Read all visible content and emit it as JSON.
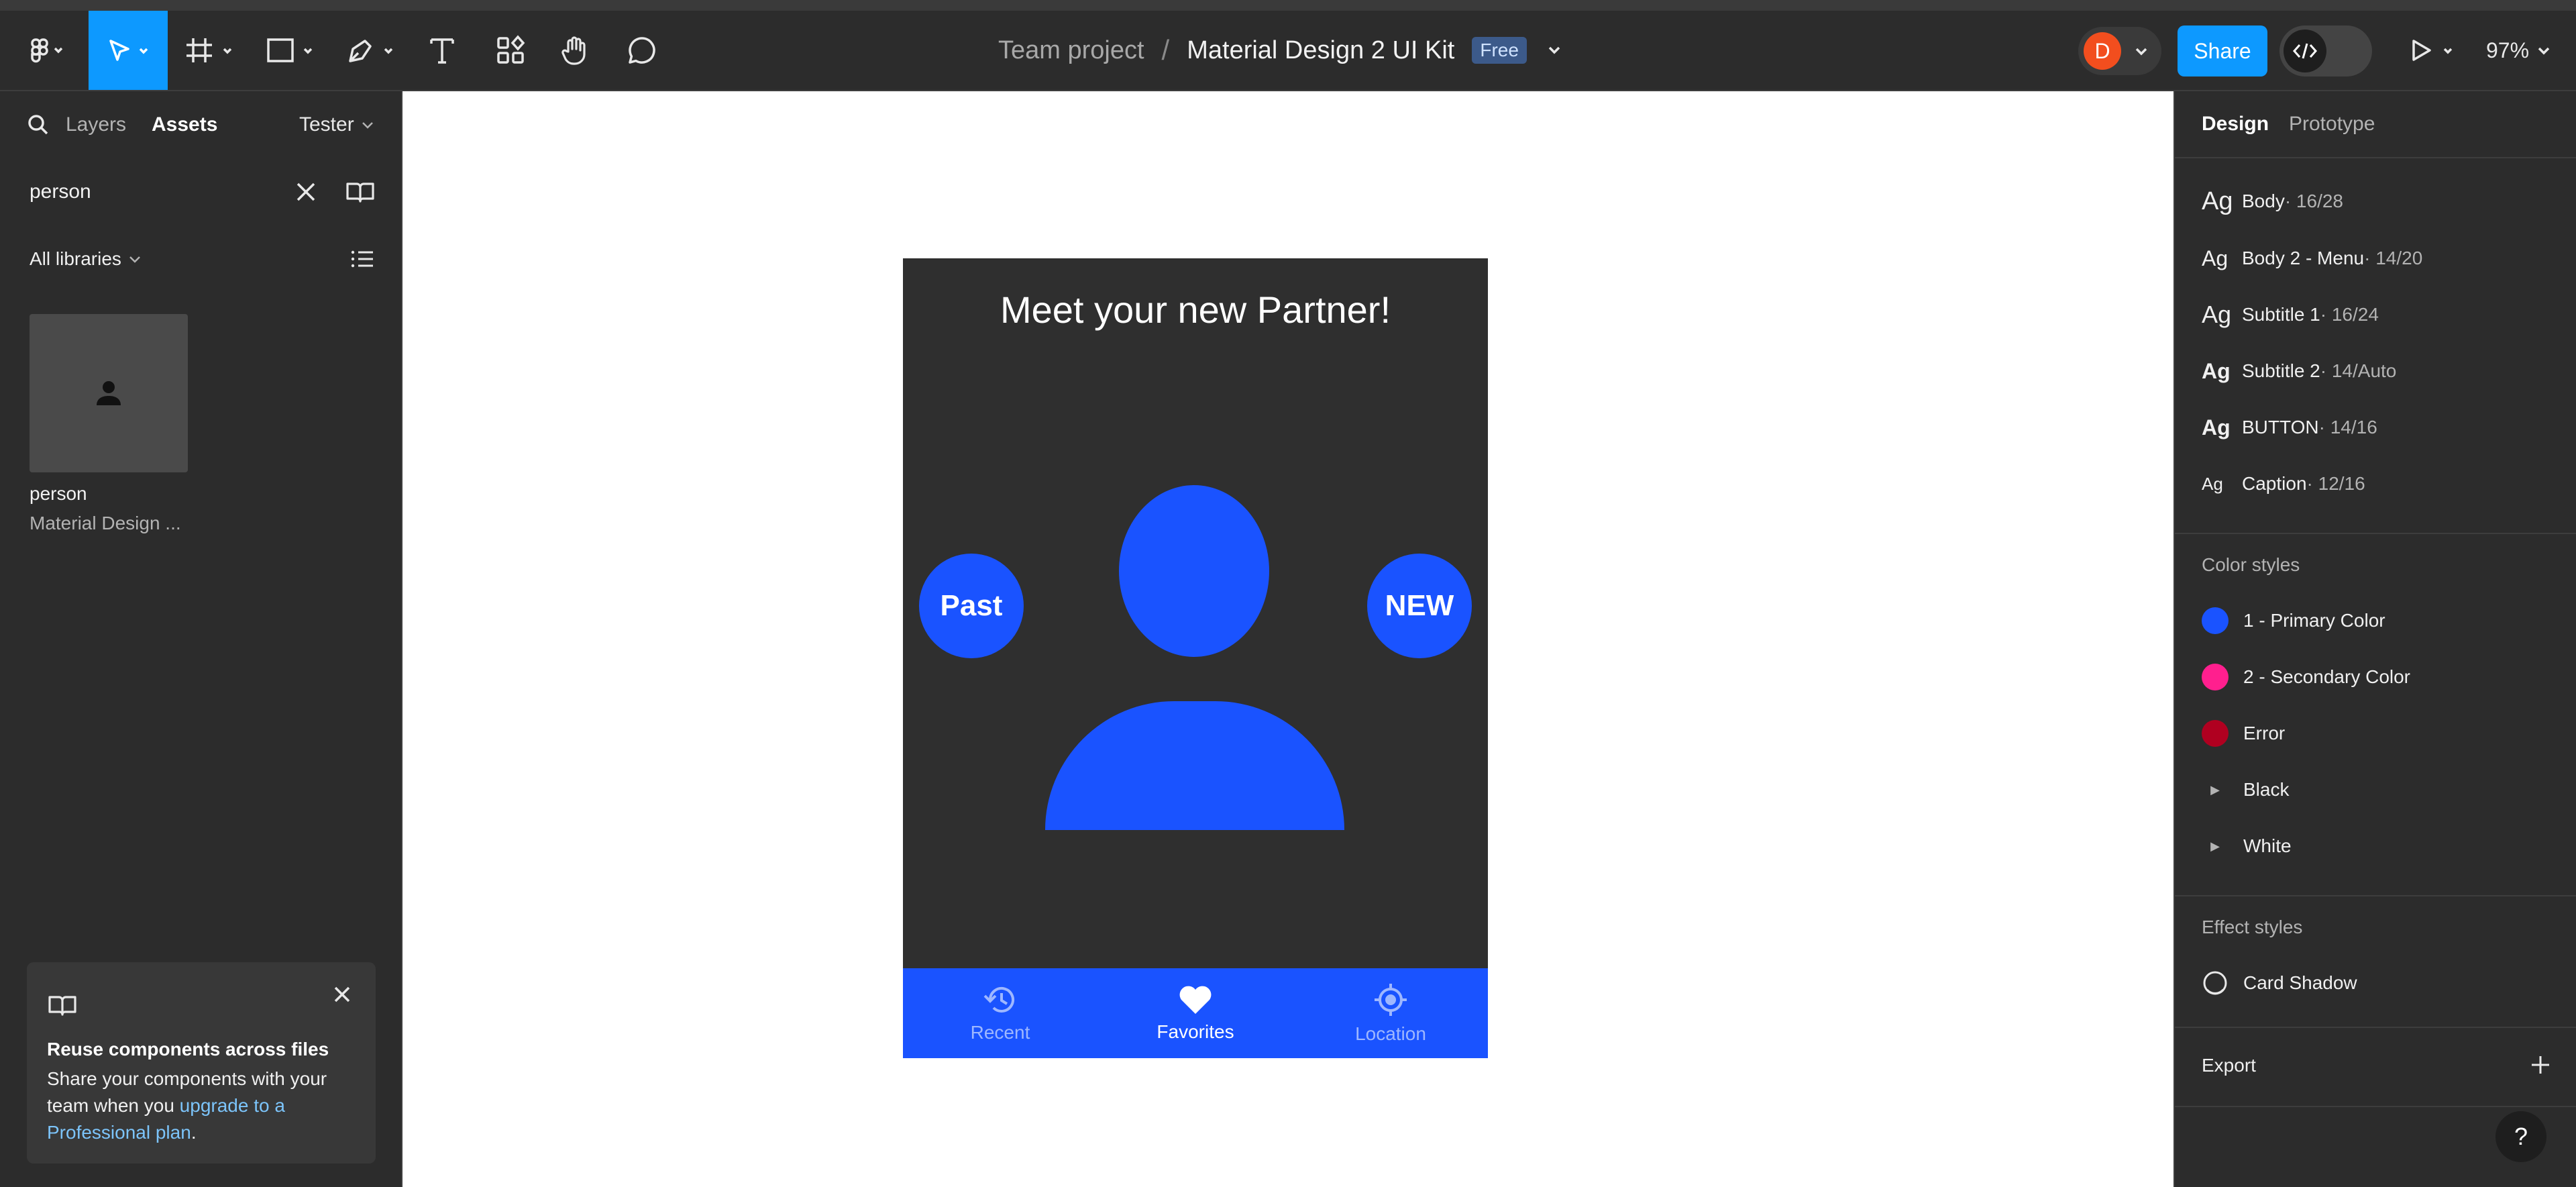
{
  "toolbar": {
    "breadcrumb_team": "Team project",
    "breadcrumb_sep": "/",
    "file_name": "Material Design 2 UI Kit",
    "plan_badge": "Free",
    "avatar_initial": "D",
    "share_label": "Share",
    "zoom": "97%",
    "accent": "#0d99ff",
    "tools": [
      "figma-menu-icon",
      "move-icon",
      "frame-icon",
      "rectangle-icon",
      "pen-icon",
      "text-icon",
      "resources-icon",
      "hand-icon",
      "comment-icon"
    ]
  },
  "left_panel": {
    "tabs": {
      "layers": "Layers",
      "assets": "Assets"
    },
    "page_selector": "Tester",
    "search_query": "person",
    "library_filter": "All libraries",
    "asset": {
      "name": "person",
      "library": "Material Design ..."
    },
    "promo": {
      "title": "Reuse components across files",
      "body": "Share your components with your team when you ",
      "link": "upgrade to a Professional plan",
      "tail": "."
    }
  },
  "canvas": {
    "frame_title": "Meet your new Partner!",
    "chip_left": "Past",
    "chip_right": "NEW",
    "primary": "#1a53ff",
    "nav": [
      {
        "label": "Recent",
        "icon": "history-icon",
        "active": false
      },
      {
        "label": "Favorites",
        "icon": "heart-icon",
        "active": true
      },
      {
        "label": "Location",
        "icon": "gps-icon",
        "active": false
      }
    ]
  },
  "right_panel": {
    "tabs": {
      "design": "Design",
      "prototype": "Prototype"
    },
    "text_styles": [
      {
        "ag": "Ag",
        "name": "Body",
        "meta": " · 16/28"
      },
      {
        "ag": "Ag",
        "name": "Body 2 - Menu",
        "meta": " · 14/20"
      },
      {
        "ag": "Ag",
        "name": "Subtitle 1",
        "meta": " · 16/24"
      },
      {
        "ag": "Ag",
        "name": "Subtitle 2",
        "meta": " · 14/Auto"
      },
      {
        "ag": "Ag",
        "name": "BUTTON",
        "meta": " · 14/16"
      },
      {
        "ag": "Ag",
        "name": "Caption",
        "meta": " · 12/16"
      }
    ],
    "color_styles_label": "Color styles",
    "color_styles": [
      {
        "name": "1 - Primary Color",
        "color": "#1a53ff"
      },
      {
        "name": "2 - Secondary Color",
        "color": "#ff1f8e"
      },
      {
        "name": "Error",
        "color": "#b00020"
      }
    ],
    "color_groups": [
      "Black",
      "White"
    ],
    "effect_styles_label": "Effect styles",
    "effect_style": "Card Shadow",
    "export_label": "Export",
    "help": "?"
  }
}
